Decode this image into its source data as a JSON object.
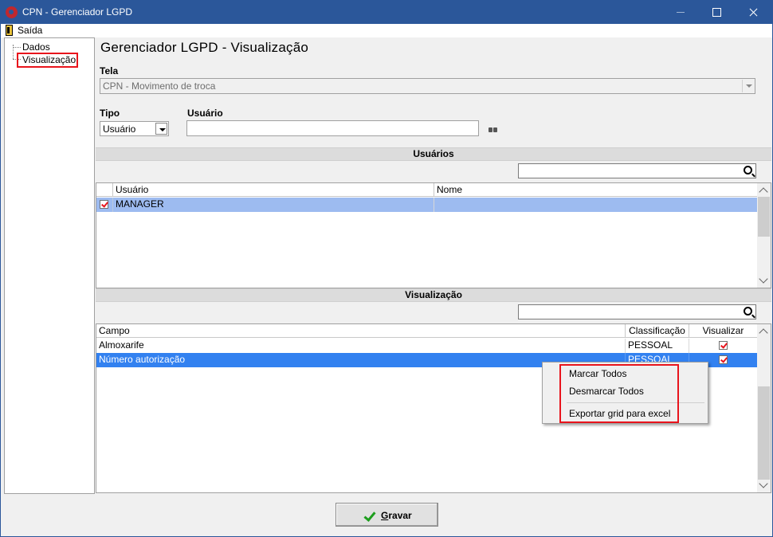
{
  "window": {
    "title": "CPN - Gerenciador LGPD"
  },
  "menu": {
    "exit_label": "Saída"
  },
  "sidebar": {
    "items": [
      {
        "label": "Dados"
      },
      {
        "label": "Visualização"
      }
    ]
  },
  "header": {
    "title": "Gerenciador LGPD - Visualização"
  },
  "form": {
    "tela_label": "Tela",
    "tela_value": "CPN - Movimento de troca",
    "tipo_label": "Tipo",
    "tipo_value": "Usuário",
    "usuario_label": "Usuário",
    "usuario_value": ""
  },
  "users_section": {
    "title": "Usuários",
    "search_value": "",
    "columns": [
      "Usuário",
      "Nome"
    ],
    "rows": [
      {
        "checked": true,
        "usuario": "MANAGER",
        "nome": ""
      }
    ]
  },
  "view_section": {
    "title": "Visualização",
    "search_value": "",
    "columns": [
      "Campo",
      "Classificação",
      "Visualizar"
    ],
    "rows": [
      {
        "campo": "Almoxarife",
        "classificacao": "PESSOAL",
        "visualizar": true
      },
      {
        "campo": "Número autorização",
        "classificacao": "PESSOAL",
        "visualizar": true
      }
    ]
  },
  "context_menu": {
    "items": [
      "Marcar Todos",
      "Desmarcar Todos",
      "Exportar grid para excel"
    ]
  },
  "footer": {
    "save_label": "Gravar"
  },
  "colors": {
    "titlebar": "#2b579a",
    "selection_blue": "#3281f0",
    "selection_light": "#9dbbf0",
    "highlight_red": "#e8141c",
    "save_check_green": "#1e9e1e"
  }
}
